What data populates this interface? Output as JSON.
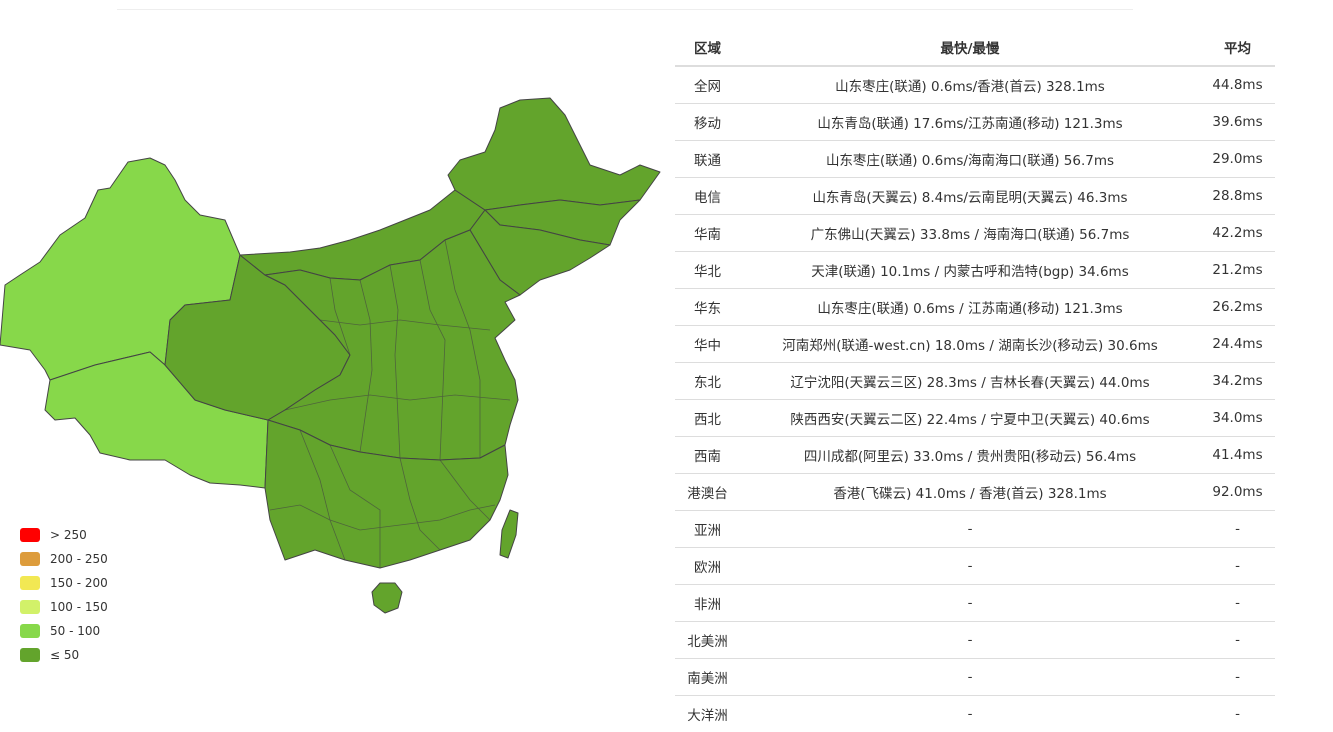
{
  "legend": [
    {
      "label": "> 250",
      "color": "#ff0000"
    },
    {
      "label": "200 - 250",
      "color": "#dd9c3c"
    },
    {
      "label": "150 - 200",
      "color": "#f2e853"
    },
    {
      "label": "100 - 150",
      "color": "#d2f169"
    },
    {
      "label": "50 - 100",
      "color": "#87d84a"
    },
    {
      "label": "≤ 50",
      "color": "#63a42c"
    }
  ],
  "table": {
    "headers": {
      "region": "区域",
      "fastest_slowest": "最快/最慢",
      "average": "平均"
    },
    "rows": [
      {
        "region": "全网",
        "fastest_slowest": "山东枣庄(联通) 0.6ms/香港(首云) 328.1ms",
        "average": "44.8ms"
      },
      {
        "region": "移动",
        "fastest_slowest": "山东青岛(联通) 17.6ms/江苏南通(移动) 121.3ms",
        "average": "39.6ms"
      },
      {
        "region": "联通",
        "fastest_slowest": "山东枣庄(联通) 0.6ms/海南海口(联通) 56.7ms",
        "average": "29.0ms"
      },
      {
        "region": "电信",
        "fastest_slowest": "山东青岛(天翼云) 8.4ms/云南昆明(天翼云) 46.3ms",
        "average": "28.8ms"
      },
      {
        "region": "华南",
        "fastest_slowest": "广东佛山(天翼云) 33.8ms / 海南海口(联通) 56.7ms",
        "average": "42.2ms"
      },
      {
        "region": "华北",
        "fastest_slowest": "天津(联通) 10.1ms / 内蒙古呼和浩特(bgp) 34.6ms",
        "average": "21.2ms"
      },
      {
        "region": "华东",
        "fastest_slowest": "山东枣庄(联通) 0.6ms / 江苏南通(移动) 121.3ms",
        "average": "26.2ms"
      },
      {
        "region": "华中",
        "fastest_slowest": "河南郑州(联通-west.cn) 18.0ms / 湖南长沙(移动云) 30.6ms",
        "average": "24.4ms"
      },
      {
        "region": "东北",
        "fastest_slowest": "辽宁沈阳(天翼云三区) 28.3ms / 吉林长春(天翼云) 44.0ms",
        "average": "34.2ms"
      },
      {
        "region": "西北",
        "fastest_slowest": "陕西西安(天翼云二区) 22.4ms / 宁夏中卫(天翼云) 40.6ms",
        "average": "34.0ms"
      },
      {
        "region": "西南",
        "fastest_slowest": "四川成都(阿里云) 33.0ms / 贵州贵阳(移动云) 56.4ms",
        "average": "41.4ms"
      },
      {
        "region": "港澳台",
        "fastest_slowest": "香港(飞碟云) 41.0ms / 香港(首云) 328.1ms",
        "average": "92.0ms"
      },
      {
        "region": "亚洲",
        "fastest_slowest": "-",
        "average": "-"
      },
      {
        "region": "欧洲",
        "fastest_slowest": "-",
        "average": "-"
      },
      {
        "region": "非洲",
        "fastest_slowest": "-",
        "average": "-"
      },
      {
        "region": "北美洲",
        "fastest_slowest": "-",
        "average": "-"
      },
      {
        "region": "南美洲",
        "fastest_slowest": "-",
        "average": "-"
      },
      {
        "region": "大洋洲",
        "fastest_slowest": "-",
        "average": "-"
      }
    ]
  },
  "map": {
    "border_color": "#444444",
    "regions": [
      {
        "id": "xinjiang",
        "bucket": "50 - 100"
      },
      {
        "id": "tibet",
        "bucket": "50 - 100"
      },
      {
        "id": "gansu-qinghai",
        "bucket": "≤ 50"
      },
      {
        "id": "inner-mongolia",
        "bucket": "≤ 50"
      },
      {
        "id": "heilongjiang",
        "bucket": "≤ 50"
      },
      {
        "id": "jilin",
        "bucket": "≤ 50"
      },
      {
        "id": "liaoning",
        "bucket": "≤ 50"
      },
      {
        "id": "central-east",
        "bucket": "≤ 50"
      },
      {
        "id": "south",
        "bucket": "≤ 50"
      },
      {
        "id": "hainan",
        "bucket": "≤ 50"
      },
      {
        "id": "taiwan",
        "bucket": "≤ 50"
      }
    ]
  }
}
